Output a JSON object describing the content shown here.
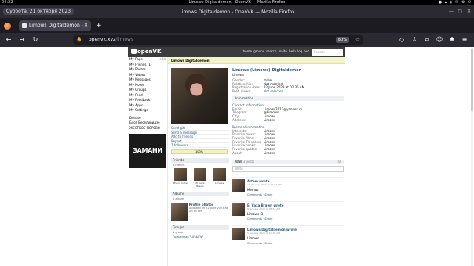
{
  "os": {
    "clock": "04:22",
    "window_title": "Limows Digitaldemon - OpenVK — Mozilla Firefox",
    "tray": "● ▴ ◈ ✉ ⚙ ⏻"
  },
  "browser": {
    "date_badge": "Суббота, 21 октября 2023",
    "title": "Limows Digitaldemon - OpenVK — Mozilla Firefox",
    "tab_title": "Limows Digitaldemon - OpenV",
    "tab_close": "✕",
    "new_tab": "+",
    "url_host": "openvk.xyz",
    "url_path": "/limows",
    "zoom": "80%",
    "win_min": "—",
    "win_max": "▢",
    "win_close": "✕"
  },
  "site": {
    "logo": "openVK",
    "menu": "home groups search invite help log out",
    "search_placeholder": "Search"
  },
  "sidebar": {
    "items": [
      {
        "label": "My Page",
        "edit": "edit"
      },
      {
        "label": "My Friends (1)"
      },
      {
        "label": "My Photos"
      },
      {
        "label": "My Videos"
      },
      {
        "label": "My Messages"
      },
      {
        "label": "My Notes"
      },
      {
        "label": "My Groups"
      },
      {
        "label": "My Feed"
      },
      {
        "label": "My Feedback"
      },
      {
        "label": "My Apps"
      },
      {
        "label": "My Settings"
      }
    ],
    "extra": [
      "Donate",
      "Блог Веселиридзе",
      "ЖЕСТКОЕ ПОРЕВО"
    ],
    "banner": "ЗАМАНИ"
  },
  "profile": {
    "page_title": "Limows Digitaldemon",
    "name": "Limows (Limows) Digitaldemon",
    "status": "Limows",
    "left_links": [
      "Send gift",
      "Send a message",
      "Add to friends",
      "Report",
      "7 followers"
    ],
    "completeness": "100%",
    "completeness_value": 1.0,
    "fields": [
      {
        "k": "Gender:",
        "v": "male"
      },
      {
        "k": "Relationship:",
        "v": "Not married"
      },
      {
        "k": "Registration date:",
        "v": "22 June 2023 at 02:35 AM"
      },
      {
        "k": "Polit. views:",
        "v": "Not selected",
        "link": true
      }
    ],
    "info_label": "Information",
    "contact_label": "Contact information",
    "contacts": [
      {
        "k": "Email:",
        "v": "Limows2013@yandex.ru"
      },
      {
        "k": "Telegram:",
        "v": "@Limows"
      },
      {
        "k": "City:",
        "v": "Limows"
      },
      {
        "k": "Address:",
        "v": "Limows"
      }
    ],
    "personal_label": "Personal information",
    "personal": [
      {
        "k": "Interests:",
        "v": "Limows"
      },
      {
        "k": "Favorite music:",
        "v": "Limows"
      },
      {
        "k": "Favorite films:",
        "v": "Limows"
      },
      {
        "k": "Favorite TV-shows:",
        "v": "Limows"
      },
      {
        "k": "Favorite books:",
        "v": "Limows"
      },
      {
        "k": "Favorite quotes:",
        "v": "Limows"
      },
      {
        "k": "About:",
        "v": "Limows"
      }
    ]
  },
  "friends": {
    "head": "Friends",
    "sub": "1 friends",
    "all": "all",
    "list": [
      {
        "name": "Pheno Inclan"
      },
      {
        "name": "El Vaxa Brawn"
      },
      {
        "name": "Limows"
      }
    ]
  },
  "albums": {
    "head": "Albums",
    "sub": "1 album",
    "all": "all",
    "title": "Profile photos",
    "meta": "Updated on 22 June 2023 at 02:35 AM"
  },
  "groups": {
    "head": "Groups",
    "sub": "1 group",
    "item": "Прицепная \"ШЪЫПУ\""
  },
  "wall": {
    "head": "Wall",
    "count": "3 posts",
    "all": "all",
    "placeholder": "Write",
    "posts": [
      {
        "author": "Artem wrote",
        "date": "15 January 2022 at 10:57 PM",
        "text": "Memus",
        "actions": "Comments · Share"
      },
      {
        "author": "El Vaxa Brawn wrote",
        "date": "8 January 2022 at 08:53 AM",
        "text": "Limows :3",
        "actions": "Comments · Share"
      },
      {
        "author": "Limows Digitaldemon wrote",
        "date": "5 January 2022 at 10:36 AM",
        "text": "Limows",
        "actions": "Comments · Share"
      }
    ]
  }
}
